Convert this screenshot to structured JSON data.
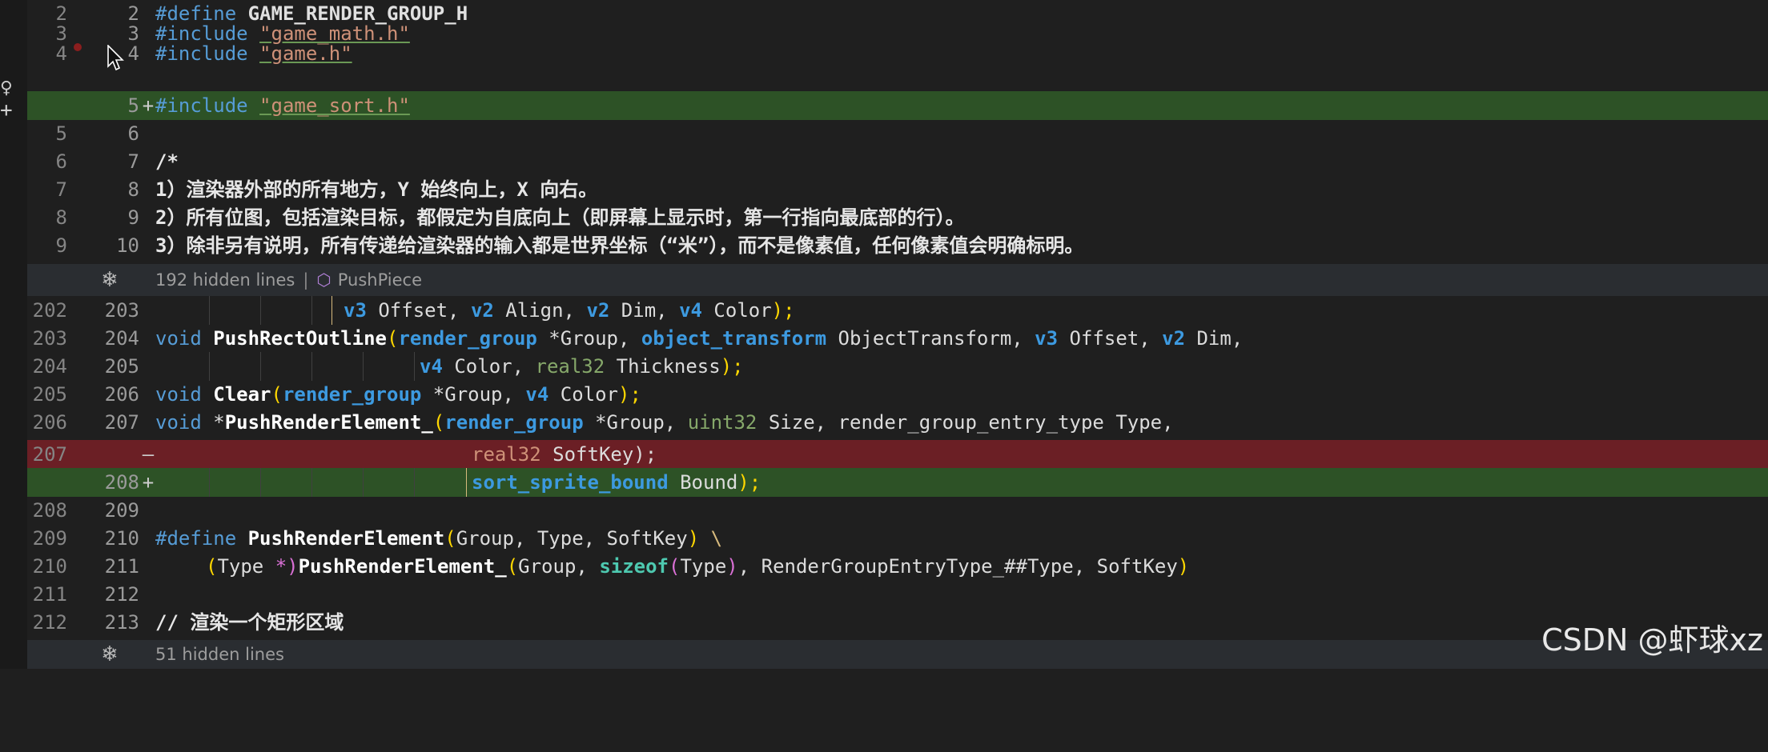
{
  "diff": {
    "lines_top": [
      {
        "old": "2",
        "new": "2",
        "marker": "",
        "type": "context",
        "text": "#define GAME_RENDER_GROUP_H"
      },
      {
        "old": "3",
        "new": "3",
        "marker": "",
        "type": "context",
        "text": "#include \"game_math.h\""
      },
      {
        "old": "4",
        "new": "4",
        "marker": "",
        "type": "context",
        "text": "#include \"game.h\""
      },
      {
        "old": "",
        "new": "5",
        "marker": "+",
        "type": "added",
        "text": "#include \"game_sort.h\""
      },
      {
        "old": "5",
        "new": "6",
        "marker": "",
        "type": "context",
        "text": ""
      },
      {
        "old": "6",
        "new": "7",
        "marker": "",
        "type": "context",
        "text": "/*"
      },
      {
        "old": "7",
        "new": "8",
        "marker": "",
        "type": "context",
        "text": "1）渲染器外部的所有地方，Y 始终向上，X 向右。"
      },
      {
        "old": "8",
        "new": "9",
        "marker": "",
        "type": "context",
        "text": "2）所有位图，包括渲染目标，都假定为自底向上（即屏幕上显示时，第一行指向最底部的行）。"
      },
      {
        "old": "9",
        "new": "10",
        "marker": "",
        "type": "context",
        "text": "3）除非另有说明，所有传递给渲染器的输入都是世界坐标（“米”），而不是像素值，任何像素值会明确标明。"
      }
    ],
    "hidden_1": {
      "count_text": "192 hidden lines",
      "separator": "|",
      "symbol": "PushPiece"
    },
    "lines_bottom": [
      {
        "old": "202",
        "new": "203",
        "marker": "",
        "type": "context",
        "text": "v3 Offset, v2 Align, v2 Dim, v4 Color);"
      },
      {
        "old": "203",
        "new": "204",
        "marker": "",
        "type": "context",
        "text": "void PushRectOutline(render_group *Group, object_transform ObjectTransform, v3 Offset, v2 Dim,"
      },
      {
        "old": "204",
        "new": "205",
        "marker": "",
        "type": "context",
        "text": "v4 Color, real32 Thickness);"
      },
      {
        "old": "205",
        "new": "206",
        "marker": "",
        "type": "context",
        "text": "void Clear(render_group *Group, v4 Color);"
      },
      {
        "old": "206",
        "new": "207",
        "marker": "",
        "type": "context",
        "text": "void *PushRenderElement_(render_group *Group, uint32 Size, render_group_entry_type Type,"
      },
      {
        "old": "207",
        "new": "",
        "marker": "—",
        "type": "removed",
        "text": "real32 SoftKey);"
      },
      {
        "old": "",
        "new": "208",
        "marker": "+",
        "type": "added",
        "text": "sort_sprite_bound Bound);"
      },
      {
        "old": "208",
        "new": "209",
        "marker": "",
        "type": "context",
        "text": ""
      },
      {
        "old": "209",
        "new": "210",
        "marker": "",
        "type": "context",
        "text": "#define PushRenderElement(Group, Type, SoftKey) \\"
      },
      {
        "old": "210",
        "new": "211",
        "marker": "",
        "type": "context",
        "text": "(Type *)PushRenderElement_(Group, sizeof(Type), RenderGroupEntryType_##Type, SoftKey)"
      },
      {
        "old": "211",
        "new": "212",
        "marker": "",
        "type": "context",
        "text": ""
      },
      {
        "old": "212",
        "new": "213",
        "marker": "",
        "type": "context",
        "text": "// 渲染一个矩形区域"
      }
    ],
    "hidden_2": {
      "count_text": "51 hidden lines"
    }
  },
  "tokens": {
    "define": "#define",
    "include": "#include",
    "guard": "GAME_RENDER_GROUP_H",
    "inc_math": "\"game_math.h\"",
    "inc_game": "\"game.h\"",
    "inc_sort": "\"game_sort.h\"",
    "comment_open": "/*",
    "v3": "v3",
    "v2": "v2",
    "v4": "v4",
    "offset": " Offset, ",
    "align": " Align, ",
    "dim": " Dim, ",
    "dim_end": " Dim,",
    "color_end": " Color",
    "paren_close_semi": ");",
    "void": "void",
    "push_rect_outline": "PushRectOutline",
    "render_group": "render_group",
    "star_group": " *Group, ",
    "object_transform": "object_transform",
    "object_transform_id": " ObjectTransform, ",
    "color_comma": " Color, ",
    "real32": "real32",
    "thickness": " Thickness",
    "clear": "Clear",
    "star": "*",
    "push_render_element_": "PushRenderElement_",
    "uint32": "uint32",
    "size": " Size, ",
    "entry_type": "render_group_entry_type Type,",
    "soft_key_semi": " SoftKey);",
    "sort_sprite_bound": "sort_sprite_bound",
    "bound": " Bound",
    "push_render_element": "PushRenderElement",
    "macro_args": "Group, Type, SoftKey",
    "backslash": " \\",
    "type_id": "Type",
    "star_paren": " *)",
    "group_comma": "Group, ",
    "sizeof": "sizeof",
    "entry_concat": ", RenderGroupEntryType_##Type, SoftKey",
    "comment_line": "// 渲染一个矩形区域"
  },
  "watermark": "CSDN @虾球xz",
  "icons": {
    "expand": "unfold-icon",
    "symbol": "cube-icon",
    "breakpoint": "breakpoint-dot",
    "cursor": "mouse-cursor-icon"
  },
  "colors": {
    "added_bg": "#2d5226",
    "removed_bg": "#6b1f25",
    "hidden_bar_bg": "#2a2d31",
    "editor_bg": "#1f1f1f"
  }
}
